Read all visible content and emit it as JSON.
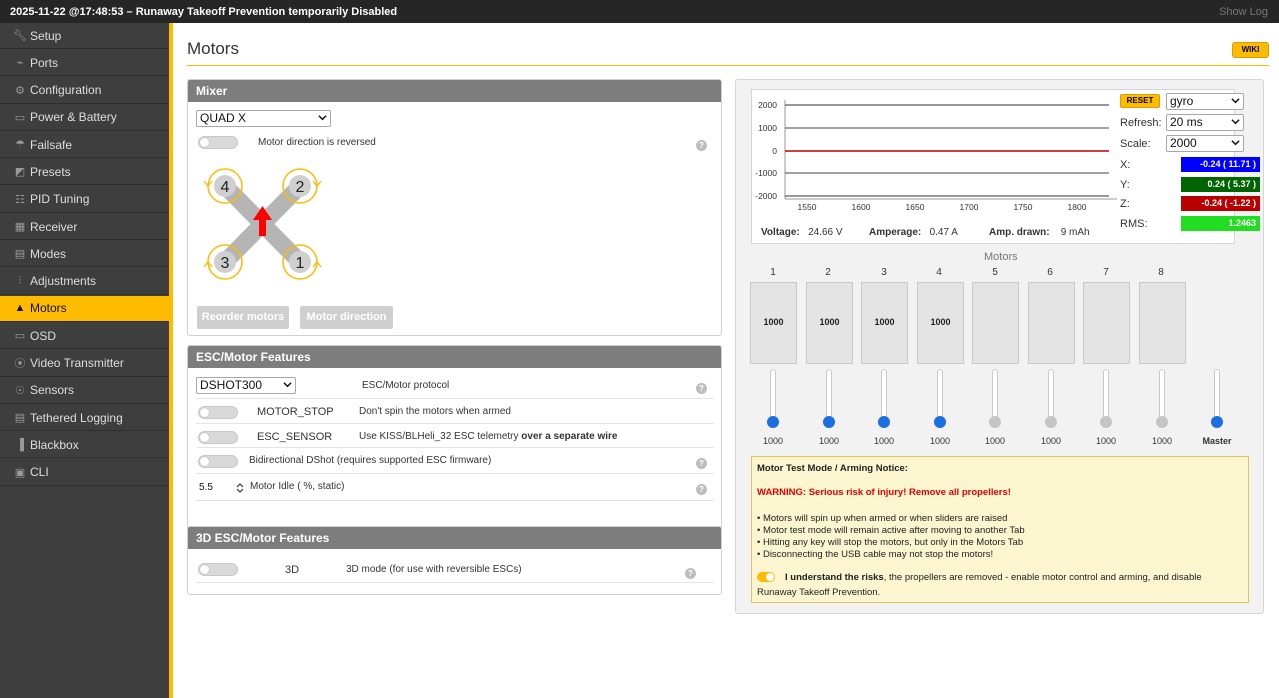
{
  "topbar": {
    "title": "2025-11-22 @17:48:53 – Runaway Takeoff Prevention temporarily Disabled",
    "show_log": "Show Log"
  },
  "sidebar": {
    "items": [
      {
        "label": "Setup",
        "icon": "wrench-icon"
      },
      {
        "label": "Ports",
        "icon": "plug-icon"
      },
      {
        "label": "Configuration",
        "icon": "gear-icon"
      },
      {
        "label": "Power & Battery",
        "icon": "battery-icon"
      },
      {
        "label": "Failsafe",
        "icon": "parachute-icon"
      },
      {
        "label": "Presets",
        "icon": "presets-icon"
      },
      {
        "label": "PID Tuning",
        "icon": "pid-icon"
      },
      {
        "label": "Receiver",
        "icon": "receiver-icon"
      },
      {
        "label": "Modes",
        "icon": "modes-icon"
      },
      {
        "label": "Adjustments",
        "icon": "sliders-icon"
      },
      {
        "label": "Motors",
        "icon": "motor-icon",
        "active": true
      },
      {
        "label": "OSD",
        "icon": "osd-icon"
      },
      {
        "label": "Video Transmitter",
        "icon": "antenna-icon"
      },
      {
        "label": "Sensors",
        "icon": "sensor-icon"
      },
      {
        "label": "Tethered Logging",
        "icon": "log-icon"
      },
      {
        "label": "Blackbox",
        "icon": "blackbox-icon"
      },
      {
        "label": "CLI",
        "icon": "cli-icon"
      }
    ]
  },
  "page": {
    "title": "Motors",
    "wiki": "WIKI"
  },
  "mixer": {
    "header": "Mixer",
    "selected": "QUAD X",
    "reversed_label": "Motor direction is reversed",
    "motor_numbers": [
      "4",
      "2",
      "3",
      "1"
    ],
    "reorder_button": "Reorder motors",
    "direction_button": "Motor direction"
  },
  "esc": {
    "header": "ESC/Motor Features",
    "protocol_selected": "DSHOT300",
    "protocol_label": "ESC/Motor protocol",
    "motor_stop_name": "MOTOR_STOP",
    "motor_stop_desc": "Don't spin the motors when armed",
    "esc_sensor_name": "ESC_SENSOR",
    "esc_sensor_desc_a": "Use KISS/BLHeli_32 ESC telemetry",
    "esc_sensor_desc_b": "over a separate wire",
    "bidir_label": "Bidirectional DShot (requires supported ESC firmware)",
    "idle_value": "5.5",
    "idle_label": "Motor Idle ( %, static)"
  },
  "esc3d": {
    "header": "3D ESC/Motor Features",
    "name": "3D",
    "desc": "3D mode (for use with reversible ESCs)"
  },
  "graph": {
    "y_ticks": [
      "2000",
      "1000",
      "0",
      "-1000",
      "-2000"
    ],
    "x_ticks": [
      "1550",
      "1600",
      "1650",
      "1700",
      "1750",
      "1800"
    ],
    "reset": "RESET",
    "source": "gyro",
    "refresh_label": "Refresh:",
    "refresh_value": "20 ms",
    "scale_label": "Scale:",
    "scale_value": "2000",
    "x_label": "X:",
    "x_value": "-0.24 ( 11.71 )",
    "y_label": "Y:",
    "y_value": "0.24 ( 5.37 )",
    "z_label": "Z:",
    "z_value": "-0.24 ( -1.22 )",
    "rms_label": "RMS:",
    "rms_value": "1.2463",
    "voltage_label": "Voltage:",
    "voltage_value": "24.66 V",
    "amperage_label": "Amperage:",
    "amperage_value": "0.47 A",
    "drawn_label": "Amp. drawn:",
    "drawn_value": "9 mAh",
    "colors": {
      "x": "#0000ff",
      "y": "#006400",
      "z": "#b80000",
      "rms": "#22dd22"
    }
  },
  "motors": {
    "title": "Motors",
    "numbers": [
      "1",
      "2",
      "3",
      "4",
      "5",
      "6",
      "7",
      "8"
    ],
    "box_values": [
      "1000",
      "1000",
      "1000",
      "1000",
      "",
      "",
      "",
      ""
    ],
    "slider_values": [
      "1000",
      "1000",
      "1000",
      "1000",
      "1000",
      "1000",
      "1000",
      "1000"
    ],
    "master_label": "Master"
  },
  "notice": {
    "title": "Motor Test Mode / Arming Notice:",
    "warning": "WARNING: Serious risk of injury! Remove all propellers!",
    "bullet1": "• Motors will spin up when armed or when sliders are raised",
    "bullet2": "• Motor test mode will remain active after moving to another Tab",
    "bullet3": "• Hitting any key will stop the motors, but only in the Motors Tab",
    "bullet4": "• Disconnecting the USB cable may not stop the motors!",
    "understand_bold": "I understand the risks",
    "understand_rest": ", the propellers are removed - enable motor control and arming, and disable",
    "understand_line2": "Runaway Takeoff Prevention."
  }
}
